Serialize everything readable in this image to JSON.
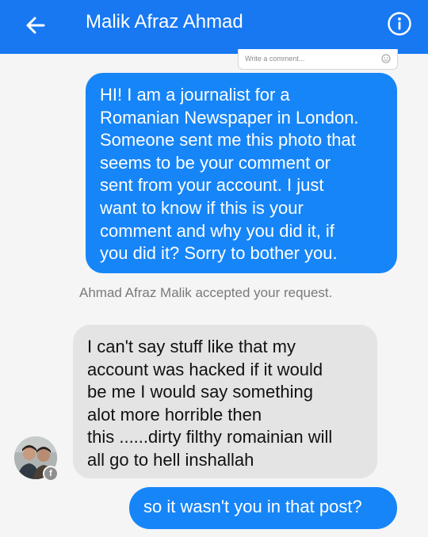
{
  "header": {
    "title": "Malik Afraz Ahmad",
    "back_icon": "back-arrow-icon",
    "info_icon": "info-icon",
    "background": "#1778f2"
  },
  "comment_box": {
    "placeholder": "Write a comment...",
    "emoji_icon": "emoji-icon"
  },
  "messages": [
    {
      "direction": "outgoing",
      "text": "HI! I am a journalist for a\nRomanian Newspaper in London.\nSomeone sent me this photo that\nseems to be your comment or\nsent from your account. I just\nwant to know if this is your\ncomment and why you did it, if\nyou did it? Sorry to bother you.",
      "color": "#1685f8"
    },
    {
      "direction": "incoming",
      "text": "I can't say stuff like that my\naccount was hacked if it would\nbe me I would say something\nalot more horrible then\nthis ......dirty filthy romainian will\nall go to hell inshallah",
      "color": "#e4e4e4"
    },
    {
      "direction": "outgoing",
      "text": "so it wasn't you in that post?",
      "color": "#1685f8"
    }
  ],
  "system_note": "Ahmad Afraz Malik accepted your request.",
  "avatar": {
    "badge_icon": "facebook-badge-icon",
    "badge_glyph": "f"
  }
}
